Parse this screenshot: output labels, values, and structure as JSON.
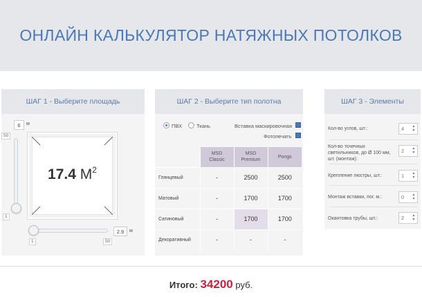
{
  "header": {
    "title": "ОНЛАЙН КАЛЬКУЛЯТОР НАТЯЖНЫХ ПОТОЛКОВ"
  },
  "step1": {
    "title": "ШАГ 1 - Выберите площадь",
    "width_value": "6",
    "width_unit": "м",
    "width_max": "50",
    "width_min": "1",
    "length_value": "2.9",
    "length_unit": "м",
    "length_min": "1",
    "length_max": "50",
    "area_value": "17.4",
    "area_unit": "М",
    "area_sup": "2"
  },
  "step2": {
    "title": "ШАГ 2 - Выберите тип полотна",
    "radio_pvc": "ПВХ",
    "radio_fabric": "Ткань",
    "selected_material": "ПВХ",
    "opt_masking": "Вставка маскировочная",
    "opt_photoprint": "Фотопечать",
    "columns": [
      {
        "line1": "MSD",
        "line2": "Classic"
      },
      {
        "line1": "MSD",
        "line2": "Premium"
      },
      {
        "line1": "Pongs",
        "line2": ""
      }
    ],
    "rows": [
      {
        "name": "Глянцевый",
        "values": [
          "-",
          "2500",
          "2500"
        ]
      },
      {
        "name": "Матовый",
        "values": [
          "-",
          "1700",
          "1700"
        ]
      },
      {
        "name": "Сатиновый",
        "values": [
          "-",
          "1700",
          "1700"
        ]
      },
      {
        "name": "Декоративный",
        "values": [
          "-",
          "-",
          "-"
        ]
      }
    ]
  },
  "step3": {
    "title": "ШАГ 3 - Элементы",
    "items": [
      {
        "label": "Кол-во углов, шт.:",
        "value": "4"
      },
      {
        "label": "Кол-во точечных светильников, до Ø 100 мм, шт. (монтаж):",
        "value": "2"
      },
      {
        "label": "Крепление люстры, шт.:",
        "value": "1"
      },
      {
        "label": "Монтаж вставки, пог. м.:",
        "value": "0"
      },
      {
        "label": "Окантовка трубы, шт.:",
        "value": "2"
      }
    ]
  },
  "total": {
    "label": "Итого:",
    "value": "34200",
    "currency": "руб."
  },
  "colors": {
    "accent": "#4a78b8",
    "total": "#cc1f3f",
    "selected_cell": "#e3dde9",
    "column_head": "#cfc9d9"
  }
}
